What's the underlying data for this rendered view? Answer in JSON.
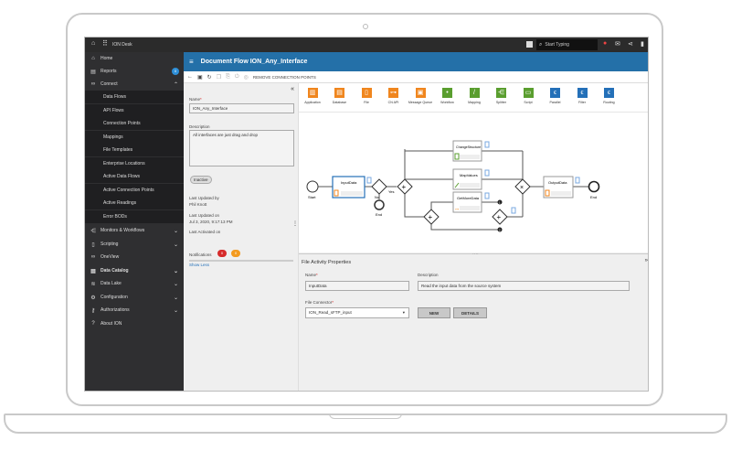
{
  "topbar": {
    "app_title": "ION Desk",
    "search_placeholder": "Start Typing"
  },
  "sidebar": {
    "items": [
      {
        "label": "Home",
        "icon": "home-icon"
      },
      {
        "label": "Reports",
        "icon": "reports-icon",
        "badge": "0"
      },
      {
        "label": "Connect",
        "icon": "connect-icon"
      },
      {
        "label": "Data Flows"
      },
      {
        "label": "API Flows"
      },
      {
        "label": "Connection Points"
      },
      {
        "label": "Mappings"
      },
      {
        "label": "File Templates"
      },
      {
        "label": "Enterprise Locations"
      },
      {
        "label": "Active Data Flows"
      },
      {
        "label": "Active Connection Points"
      },
      {
        "label": "Active Readings"
      },
      {
        "label": "Error BODs"
      },
      {
        "label": "Monitors & Workflows",
        "icon": "monitors-icon"
      },
      {
        "label": "Scripting",
        "icon": "scripting-icon"
      },
      {
        "label": "OneView",
        "icon": "oneview-icon"
      },
      {
        "label": "Data Catalog",
        "icon": "data-catalog-icon"
      },
      {
        "label": "Data Lake",
        "icon": "data-lake-icon"
      },
      {
        "label": "Configuration",
        "icon": "gear-icon"
      },
      {
        "label": "Authorizations",
        "icon": "key-icon"
      },
      {
        "label": "About ION",
        "icon": "question-icon"
      }
    ]
  },
  "header": {
    "title": "Document Flow ION_Any_Interface"
  },
  "toolbar": {
    "remove_label": "REMOVE CONNECTION POINTS"
  },
  "left_panel": {
    "name_label": "Name",
    "name_value": "ION_Any_Interface",
    "description_label": "Description",
    "description_value": "All interfaces are just drag and drop",
    "status": "Inactive",
    "last_updated_by_label": "Last Updated by",
    "last_updated_by": "Phil Knott",
    "last_updated_on_label": "Last Updated on",
    "last_updated_on": "Jul 3, 2020, 9:17:13 PM",
    "last_activated_label": "Last Activated on",
    "notifications_label": "Notifications",
    "notif_red": "0",
    "notif_orange": "0",
    "show_less": "Show Less"
  },
  "palette": [
    {
      "label": "Application",
      "color": "#f0861e",
      "glyph": "▥"
    },
    {
      "label": "Database",
      "color": "#f0861e",
      "glyph": "▤"
    },
    {
      "label": "File",
      "color": "#f0861e",
      "glyph": "▯"
    },
    {
      "label": "CN API",
      "color": "#f0861e",
      "glyph": "⊶"
    },
    {
      "label": "Message Queue",
      "color": "#f0861e",
      "glyph": "▣"
    },
    {
      "label": "Workflow",
      "color": "#5a9e2f",
      "glyph": "•"
    },
    {
      "label": "Mapping",
      "color": "#5a9e2f",
      "glyph": "/"
    },
    {
      "label": "Splitter",
      "color": "#5a9e2f",
      "glyph": "⋲"
    },
    {
      "label": "Script",
      "color": "#5a9e2f",
      "glyph": "▭"
    },
    {
      "label": "Parallel",
      "color": "#2470b8",
      "glyph": "ϵ"
    },
    {
      "label": "Filter",
      "color": "#2470b8",
      "glyph": "ϵ"
    },
    {
      "label": "Routing",
      "color": "#2470b8",
      "glyph": "ϵ"
    }
  ],
  "diagram": {
    "start": "Start",
    "end_no": "End",
    "end": "End",
    "yes": "Yes",
    "no": "No",
    "nodes": {
      "input": "InputData",
      "change": "ChangeStructure",
      "map": "MapValues",
      "get": "GetMoreData",
      "output": "OutputData"
    },
    "counters": [
      "1",
      "2"
    ]
  },
  "props": {
    "title": "File Activity Properties",
    "name_label": "Name",
    "name_value": "InputData",
    "description_label": "Description",
    "description_value": "Read the input data from the source system",
    "connector_label": "File Connector",
    "connector_value": "ION_Read_sFTP_input",
    "new_label": "NEW",
    "details_label": "DETAILS"
  }
}
